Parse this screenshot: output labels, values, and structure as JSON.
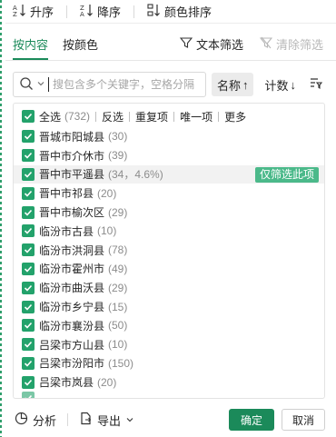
{
  "sort_bar": {
    "ascending_label": "升序",
    "descending_label": "降序",
    "color_sort_label": "颜色排序"
  },
  "tabs": {
    "by_content": "按内容",
    "by_color": "按颜色",
    "text_filter": "文本筛选",
    "clear_filter": "清除筛选"
  },
  "search": {
    "placeholder": "搜包含多个关键字，空格分隔",
    "value": "",
    "sort_name_label": "名称",
    "sort_name_arrow": "↑",
    "sort_count_label": "计数",
    "sort_count_arrow": "↓"
  },
  "select_all": {
    "label": "全选",
    "count": "(732)",
    "actions": [
      "反选",
      "重复项",
      "唯一项",
      "更多"
    ]
  },
  "items": [
    {
      "name": "晋城市阳城县",
      "count": "(30)",
      "checked": true
    },
    {
      "name": "晋中市介休市",
      "count": "(39)",
      "checked": true
    },
    {
      "name": "晋中市平遥县",
      "count": "(34，4.6%)",
      "checked": true,
      "highlight": true
    },
    {
      "name": "晋中市祁县",
      "count": "(20)",
      "checked": true
    },
    {
      "name": "晋中市榆次区",
      "count": "(29)",
      "checked": true
    },
    {
      "name": "临汾市古县",
      "count": "(10)",
      "checked": true
    },
    {
      "name": "临汾市洪洞县",
      "count": "(78)",
      "checked": true
    },
    {
      "name": "临汾市霍州市",
      "count": "(49)",
      "checked": true
    },
    {
      "name": "临汾市曲沃县",
      "count": "(29)",
      "checked": true
    },
    {
      "name": "临汾市乡宁县",
      "count": "(15)",
      "checked": true
    },
    {
      "name": "临汾市襄汾县",
      "count": "(50)",
      "checked": true
    },
    {
      "name": "吕梁市方山县",
      "count": "(10)",
      "checked": true
    },
    {
      "name": "吕梁市汾阳市",
      "count": "(150)",
      "checked": true
    },
    {
      "name": "吕梁市岚县",
      "count": "(20)",
      "checked": true
    }
  ],
  "only_filter_label": "仅筛选此项",
  "footer": {
    "analyze_label": "分析",
    "export_label": "导出",
    "ok_label": "确定",
    "cancel_label": "取消"
  },
  "colors": {
    "accent": "#1b8a5a",
    "checkbox": "#23a26b",
    "only_button": "#4bb98a"
  }
}
